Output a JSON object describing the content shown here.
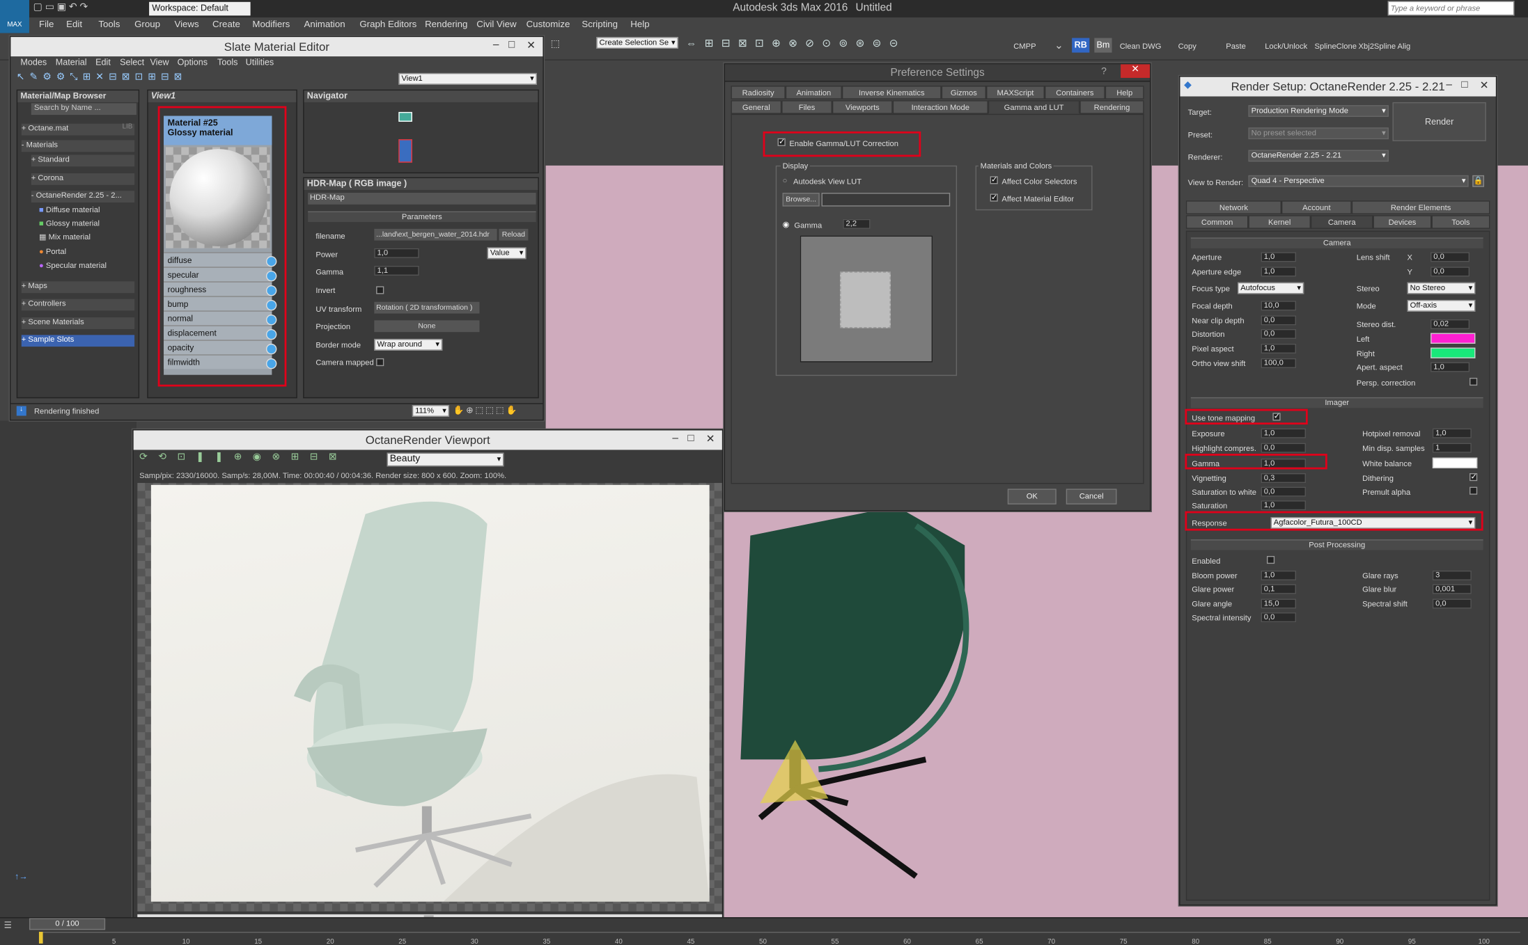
{
  "app": {
    "title": "Autodesk 3ds Max 2016",
    "doc": "Untitled",
    "workspace": "Workspace: Default",
    "search_placeholder": "Type a keyword or phrase",
    "logo": "MAX"
  },
  "menubar": [
    "File",
    "Edit",
    "Tools",
    "Group",
    "Views",
    "Create",
    "Modifiers",
    "Animation",
    "Graph Editors",
    "Rendering",
    "Civil View",
    "Customize",
    "Scripting",
    "Help"
  ],
  "toolbar": {
    "selection_set": "Create Selection Se",
    "items": [
      "CMPP",
      "RB",
      "Bm",
      "Clean DWG",
      "Copy",
      "Paste",
      "Lock/Unlock",
      "SplineClone",
      "Xbj2Spline Alig"
    ]
  },
  "slate": {
    "title": "Slate Material Editor",
    "menu": [
      "Modes",
      "Material",
      "Edit",
      "Select",
      "View",
      "Options",
      "Tools",
      "Utilities"
    ],
    "view_select": "View1",
    "browser_title": "Material/Map Browser",
    "search": "Search by Name ...",
    "tree": [
      "+ Octane.mat",
      "- Materials",
      "+ Standard",
      "+ Corona",
      "- OctaneRender 2.25 - 2...",
      "Diffuse material",
      "Glossy material",
      "Mix material",
      "Portal",
      "Specular material",
      "+ Maps",
      "+ Controllers",
      "+ Scene Materials",
      "+ Sample Slots"
    ],
    "lib": "LIB",
    "view_tab": "View1",
    "node_name": "Material #25",
    "node_type": "Glossy material",
    "slots": [
      "diffuse",
      "specular",
      "roughness",
      "bump",
      "normal",
      "displacement",
      "opacity",
      "filmwidth"
    ],
    "navigator": "Navigator",
    "status": "Rendering finished",
    "zoom": "111%"
  },
  "hdr": {
    "title": "HDR-Map  ( RGB image )",
    "name": "HDR-Map",
    "section": "Parameters",
    "filename_lbl": "filename",
    "filename": "...land\\ext_bergen_water_2014.hdr",
    "reload": "Reload",
    "power_lbl": "Power",
    "power": "1,0",
    "value_mode": "Value",
    "gamma_lbl": "Gamma",
    "gamma": "1,1",
    "invert_lbl": "Invert",
    "uv_lbl": "UV transform",
    "uv": "Rotation  ( 2D transformation )",
    "proj_lbl": "Projection",
    "proj": "None",
    "border_lbl": "Border mode",
    "border": "Wrap around",
    "cam_lbl": "Camera mapped"
  },
  "viewport": {
    "title": "OctaneRender Viewport",
    "mode": "Beauty",
    "status": "Samp/pix: 2330/16000.   Samp/s: 28,00M.   Time: 00:00:40 / 00:04:36.   Render size: 800 x 600.   Zoom: 100%."
  },
  "pref": {
    "title": "Preference Settings",
    "tabs_top": [
      "Radiosity",
      "Animation",
      "Inverse Kinematics",
      "Gizmos",
      "MAXScript",
      "Containers",
      "Help"
    ],
    "tabs_bottom": [
      "General",
      "Files",
      "Viewports",
      "Interaction Mode",
      "Gamma and LUT",
      "Rendering"
    ],
    "enable": "Enable Gamma/LUT Correction",
    "display": "Display",
    "lut": "Autodesk View LUT",
    "browse": "Browse...",
    "gamma_lbl": "Gamma",
    "gamma": "2,2",
    "mc": "Materials and Colors",
    "acs": "Affect Color Selectors",
    "ame": "Affect Material Editor",
    "ok": "OK",
    "cancel": "Cancel"
  },
  "render": {
    "title": "Render Setup: OctaneRender 2.25 - 2.21",
    "target_lbl": "Target:",
    "target": "Production Rendering Mode",
    "preset_lbl": "Preset:",
    "preset": "No preset selected",
    "renderer_lbl": "Renderer:",
    "renderer": "OctaneRender 2.25 - 2.21",
    "vtr_lbl": "View to Render:",
    "vtr": "Quad 4 - Perspective",
    "render_btn": "Render",
    "tabs1": [
      "Network",
      "Account",
      "Render Elements"
    ],
    "tabs2": [
      "Common",
      "Kernel",
      "Camera",
      "Devices",
      "Tools"
    ],
    "camera": "Camera",
    "cam_left": [
      [
        "Aperture",
        "1,0"
      ],
      [
        "Aperture edge",
        "1,0"
      ],
      [
        "Focus type",
        "Autofocus"
      ],
      [
        "Focal depth",
        "10,0"
      ],
      [
        "Near clip depth",
        "0,0"
      ],
      [
        "Distortion",
        "0,0"
      ],
      [
        "Pixel aspect",
        "1,0"
      ],
      [
        "Ortho view shift",
        "100,0"
      ]
    ],
    "cam_right": [
      [
        "Lens shift",
        ""
      ],
      [
        "Stereo",
        "No Stereo"
      ],
      [
        "Mode",
        "Off-axis"
      ],
      [
        "Stereo dist.",
        "0,02"
      ],
      [
        "Left",
        ""
      ],
      [
        "Right",
        ""
      ],
      [
        "Apert. aspect",
        "1,0"
      ],
      [
        "Persp. correction",
        ""
      ]
    ],
    "lx": "X",
    "ly": "Y",
    "lxv": "0,0",
    "lyv": "0,0",
    "imager": "Imager",
    "tone": "Use tone mapping",
    "img_left": [
      [
        "Exposure",
        "1,0"
      ],
      [
        "Highlight compres.",
        "0,0"
      ],
      [
        "Gamma",
        "1,0"
      ],
      [
        "Vignetting",
        "0,3"
      ],
      [
        "Saturation to white",
        "0,0"
      ],
      [
        "Saturation",
        "1,0"
      ]
    ],
    "img_right": [
      [
        "Hotpixel removal",
        "1,0"
      ],
      [
        "Min disp. samples",
        "1"
      ],
      [
        "White balance",
        ""
      ],
      [
        "Dithering",
        ""
      ],
      [
        "Premult alpha",
        ""
      ]
    ],
    "response_lbl": "Response",
    "response": "Agfacolor_Futura_100CD",
    "post": "Post Processing",
    "enabled": "Enabled",
    "post_left": [
      [
        "Bloom power",
        "1,0"
      ],
      [
        "Glare power",
        "0,1"
      ],
      [
        "Glare angle",
        "15,0"
      ],
      [
        "Spectral intensity",
        "0,0"
      ]
    ],
    "post_right": [
      [
        "Glare rays",
        "3"
      ],
      [
        "Glare blur",
        "0,001"
      ],
      [
        "Spectral shift",
        "0,0"
      ]
    ],
    "left_color": "#ff1fd2",
    "right_color": "#19e87a"
  },
  "timeline": {
    "frame": "0 / 100",
    "ticks": [
      "5",
      "10",
      "15",
      "20",
      "25",
      "30",
      "35",
      "40",
      "45",
      "50",
      "55",
      "60",
      "65",
      "70",
      "75",
      "80",
      "85",
      "90",
      "95",
      "100"
    ]
  }
}
